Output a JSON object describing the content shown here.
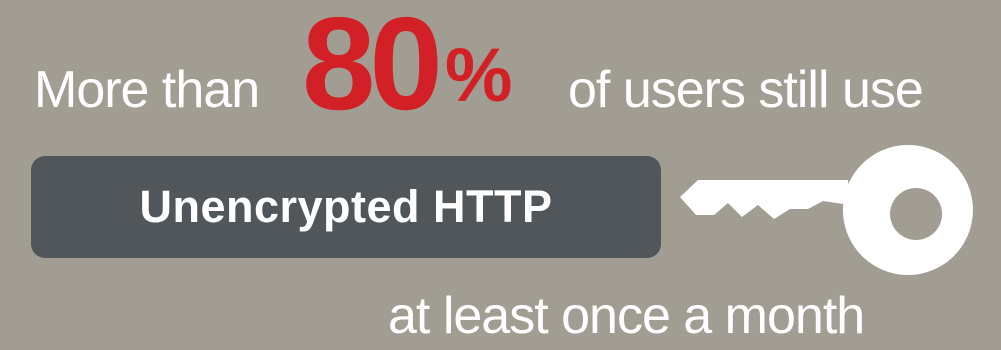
{
  "headline": {
    "prefix": "More than",
    "stat": "80",
    "stat_unit": "%",
    "suffix": "of users still use"
  },
  "pill": {
    "label": "Unencrypted HTTP"
  },
  "icon": {
    "name": "key-icon"
  },
  "footer": {
    "text": "at least once a month"
  },
  "colors": {
    "background": "#a19d92",
    "accent": "#d31f26",
    "pill": "#51565a",
    "text": "#ffffff"
  }
}
